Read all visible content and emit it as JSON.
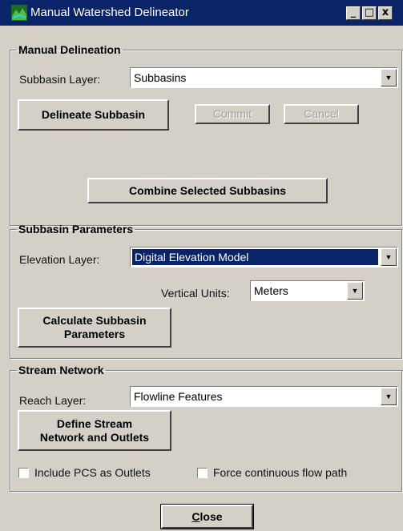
{
  "window": {
    "title": "Manual Watershed Delineator"
  },
  "titlebar_buttons": {
    "minimize": "_",
    "maximize": "□",
    "close": "x"
  },
  "manual_delineation": {
    "legend": "Manual Delineation",
    "subbasin_layer_label": "Subbasin Layer:",
    "subbasin_layer_value": "Subbasins",
    "delineate_button": "Delineate Subbasin",
    "commit_button": "Commit",
    "cancel_button": "Cancel",
    "combine_button": "Combine Selected Subbasins"
  },
  "subbasin_parameters": {
    "legend": "Subbasin Parameters",
    "elevation_layer_label": "Elevation Layer:",
    "elevation_layer_value": "Digital Elevation Model",
    "vertical_units_label": "Vertical Units:",
    "vertical_units_value": "Meters",
    "calculate_button_line1": "Calculate Subbasin",
    "calculate_button_line2": "Parameters"
  },
  "stream_network": {
    "legend": "Stream Network",
    "reach_layer_label": "Reach Layer:",
    "reach_layer_value": "Flowline Features",
    "define_button_line1": "Define Stream",
    "define_button_line2": "Network and Outlets",
    "include_pcs_label": "Include PCS as Outlets",
    "force_flow_label": "Force continuous flow path"
  },
  "footer": {
    "close_prefix": "",
    "close_mnemonic": "C",
    "close_rest": "lose"
  },
  "colors": {
    "titlebar": "#0a246a",
    "face": "#d4d0c8",
    "selection": "#0a246a"
  }
}
